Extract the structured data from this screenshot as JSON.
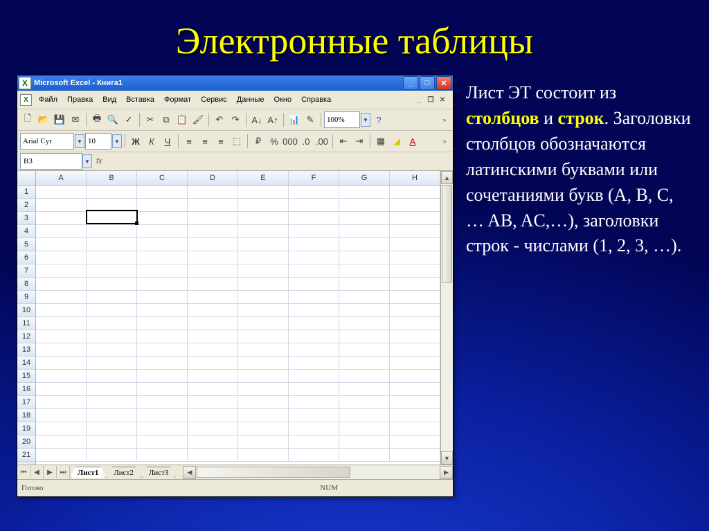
{
  "slide_title": "Электронные таблицы",
  "window_title": "Microsoft Excel - Книга1",
  "menu": [
    "Файл",
    "Правка",
    "Вид",
    "Вставка",
    "Формат",
    "Сервис",
    "Данные",
    "Окно",
    "Справка"
  ],
  "font_name": "Arial Cyr",
  "font_size": "10",
  "zoom": "100%",
  "active_cell": "B3",
  "columns": [
    "A",
    "B",
    "C",
    "D",
    "E",
    "F",
    "G",
    "H"
  ],
  "rows": [
    "1",
    "2",
    "3",
    "4",
    "5",
    "6",
    "7",
    "8",
    "9",
    "10",
    "11",
    "12",
    "13",
    "14",
    "15",
    "16",
    "17",
    "18",
    "19",
    "20",
    "21"
  ],
  "tabs": [
    "Лист1",
    "Лист2",
    "Лист3"
  ],
  "status": "Готово",
  "status_ind": "NUM",
  "txt": {
    "p1": "Лист ЭТ состоит из ",
    "c": "столбцов",
    "p2": " и ",
    "r": "строк",
    "p3": ". Заголовки столбцов обозначаются латинскими буквами или сочетаниями букв (A, B, C, … AB, AC,…), заголовки строк - числами (1, 2, 3, …)."
  }
}
